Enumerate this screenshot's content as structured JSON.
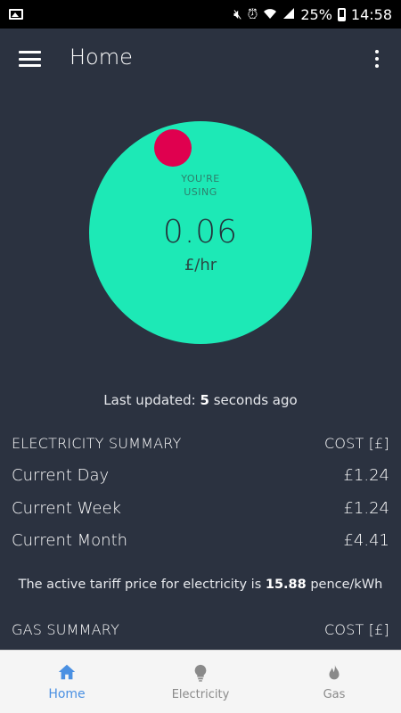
{
  "status_bar": {
    "battery": "25%",
    "time": "14:58"
  },
  "app_bar": {
    "title": "Home"
  },
  "usage": {
    "caption_line1": "YOU'RE",
    "caption_line2": "USING",
    "value": "0.06",
    "unit": "£/hr"
  },
  "last_updated": {
    "prefix": "Last updated: ",
    "value": "5",
    "suffix": " seconds ago"
  },
  "electricity_summary": {
    "title": "ELECTRICITY SUMMARY",
    "cost_header": "COST [£]",
    "rows": [
      {
        "label": "Current Day",
        "value": "£1.24"
      },
      {
        "label": "Current Week",
        "value": "£1.24"
      },
      {
        "label": "Current Month",
        "value": "£4.41"
      }
    ]
  },
  "tariff": {
    "prefix": "The active tariff price for electricity is ",
    "value": "15.88",
    "suffix": " pence/kWh"
  },
  "gas_summary": {
    "title": "GAS SUMMARY",
    "cost_header": "COST [£]"
  },
  "bottom_nav": {
    "items": [
      {
        "label": "Home",
        "icon": "home-icon",
        "active": true
      },
      {
        "label": "Electricity",
        "icon": "lightbulb-icon",
        "active": false
      },
      {
        "label": "Gas",
        "icon": "flame-icon",
        "active": false
      }
    ]
  },
  "colors": {
    "background": "#2b3240",
    "usage_circle": "#1de9b6",
    "usage_dot": "#e0004f",
    "nav_active": "#4a90e2"
  }
}
